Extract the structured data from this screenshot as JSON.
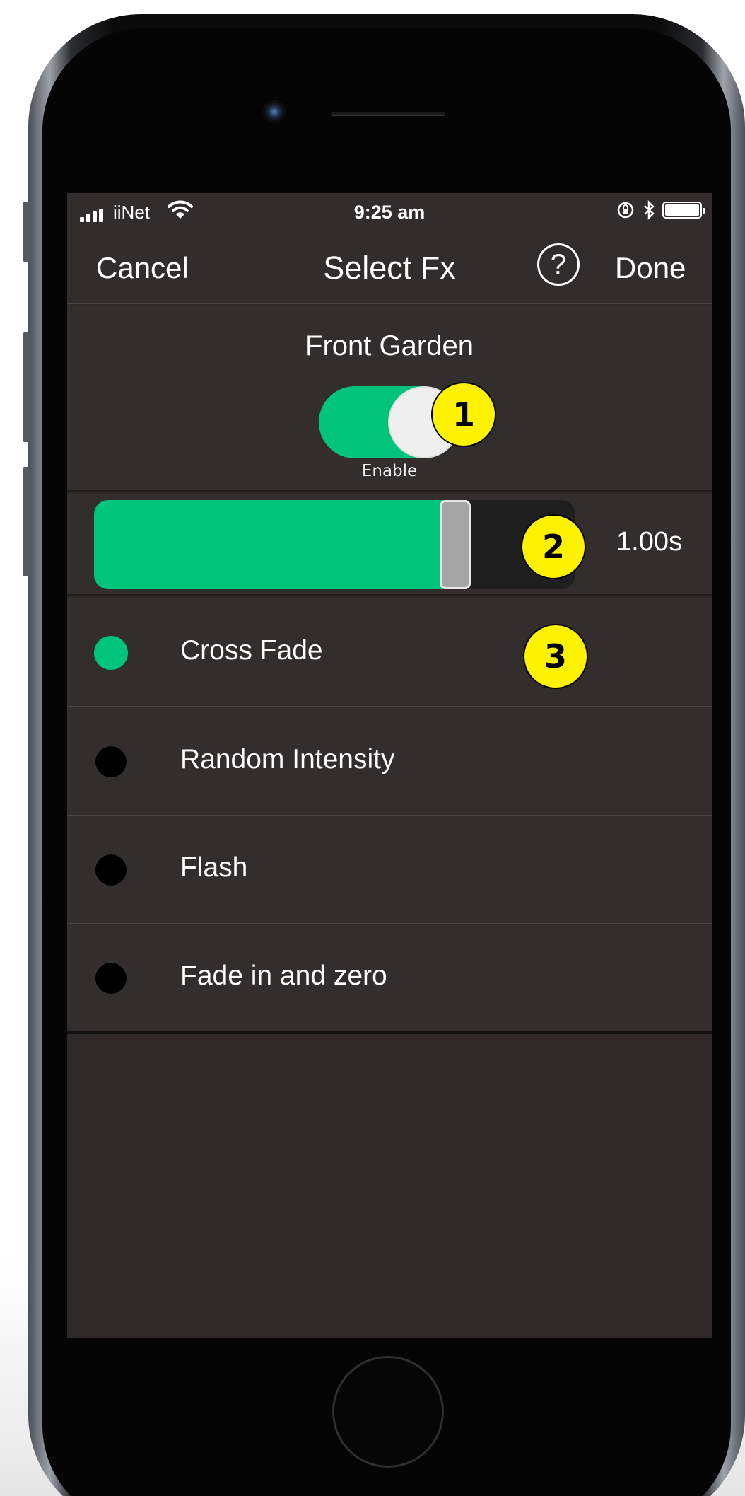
{
  "status_bar": {
    "carrier": "iiNet",
    "time": "9:25 am",
    "icons": [
      "signal-bars-icon",
      "wifi-icon",
      "orientation-lock-icon",
      "bluetooth-icon",
      "battery-icon"
    ]
  },
  "nav": {
    "cancel": "Cancel",
    "title": "Select Fx",
    "help": "?",
    "done": "Done"
  },
  "header": {
    "zone_name": "Front Garden",
    "enable_label": "Enable",
    "enabled": true
  },
  "slider": {
    "value_label": "1.00s",
    "fill_fraction": 0.75
  },
  "effects": [
    {
      "label": "Cross Fade",
      "selected": true
    },
    {
      "label": "Random Intensity",
      "selected": false
    },
    {
      "label": "Flash",
      "selected": false
    },
    {
      "label": "Fade in and zero",
      "selected": false
    }
  ],
  "callouts": [
    "1",
    "2",
    "3"
  ],
  "colors": {
    "accent": "#00c47c",
    "background": "#2f2a29",
    "callout": "#fff200"
  }
}
